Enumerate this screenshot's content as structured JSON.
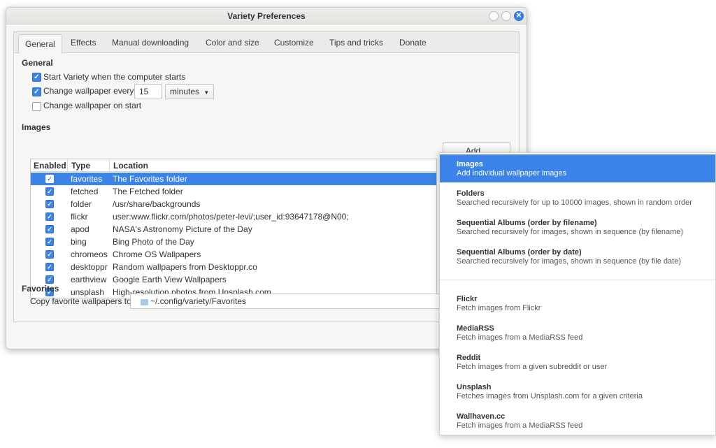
{
  "window": {
    "title": "Variety Preferences"
  },
  "tabs": [
    {
      "label": "General"
    },
    {
      "label": "Effects"
    },
    {
      "label": "Manual downloading"
    },
    {
      "label": "Color and size"
    },
    {
      "label": "Customize"
    },
    {
      "label": "Tips and tricks"
    },
    {
      "label": "Donate"
    }
  ],
  "general": {
    "heading": "General",
    "start_on_boot": {
      "label": "Start Variety when the computer starts",
      "checked": true
    },
    "change_every": {
      "label": "Change wallpaper every",
      "checked": true,
      "value": "15",
      "unit": "minutes"
    },
    "change_on_start": {
      "label": "Change wallpaper on start",
      "checked": false
    }
  },
  "images": {
    "heading": "Images",
    "columns": {
      "enabled": "Enabled",
      "type": "Type",
      "location": "Location"
    },
    "rows": [
      {
        "type": "favorites",
        "location": "The Favorites folder"
      },
      {
        "type": "fetched",
        "location": "The Fetched folder"
      },
      {
        "type": "folder",
        "location": "/usr/share/backgrounds"
      },
      {
        "type": "flickr",
        "location": "user:www.flickr.com/photos/peter-levi/;user_id:93647178@N00;"
      },
      {
        "type": "apod",
        "location": "NASA's Astronomy Picture of the Day"
      },
      {
        "type": "bing",
        "location": "Bing Photo of the Day"
      },
      {
        "type": "chromeos",
        "location": "Chrome OS Wallpapers"
      },
      {
        "type": "desktoppr",
        "location": "Random wallpapers from Desktoppr.co"
      },
      {
        "type": "earthview",
        "location": "Google Earth View Wallpapers"
      },
      {
        "type": "unsplash",
        "location": "High-resolution photos from Unsplash.com"
      }
    ],
    "add_button": "Add..."
  },
  "favorites": {
    "heading": "Favorites",
    "copy_label": "Copy favorite wallpapers to",
    "path": "~/.config/variety/Favorites"
  },
  "menu": {
    "items": [
      {
        "title": "Images",
        "desc": "Add individual wallpaper images"
      },
      {
        "title": "Folders",
        "desc": "Searched recursively for up to 10000 images, shown in random order"
      },
      {
        "title": "Sequential Albums (order by filename)",
        "desc": "Searched recursively for images, shown in sequence (by filename)"
      },
      {
        "title": "Sequential Albums (order by date)",
        "desc": "Searched recursively for images, shown in sequence (by file date)"
      },
      {
        "title": "Flickr",
        "desc": "Fetch images from Flickr"
      },
      {
        "title": "MediaRSS",
        "desc": "Fetch images from a MediaRSS feed"
      },
      {
        "title": "Reddit",
        "desc": "Fetch images from a given subreddit or user"
      },
      {
        "title": "Unsplash",
        "desc": "Fetches images from Unsplash.com for a given criteria"
      },
      {
        "title": "Wallhaven.cc",
        "desc": "Fetch images from a MediaRSS feed"
      }
    ]
  },
  "colors": {
    "accent": "#3b83e8"
  }
}
